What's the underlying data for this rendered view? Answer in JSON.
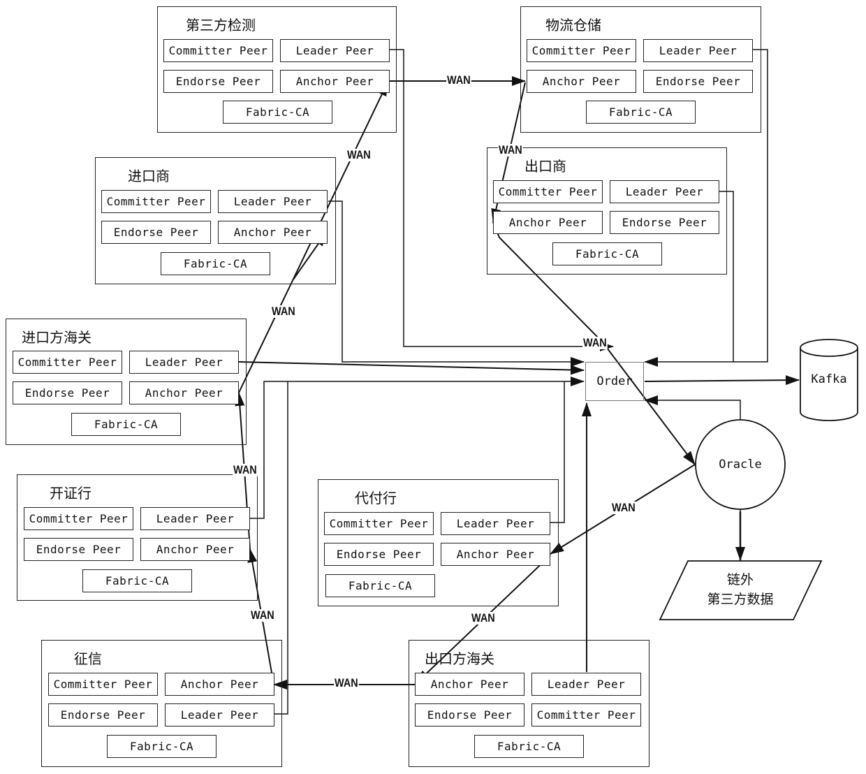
{
  "orgs": {
    "third_party_testing": {
      "title": "第三方检测",
      "peers": [
        "Committer Peer",
        "Leader Peer",
        "Endorse Peer",
        "Anchor Peer"
      ],
      "ca": "Fabric-CA"
    },
    "logistics_warehouse": {
      "title": "物流仓储",
      "peers": [
        "Committer Peer",
        "Leader Peer",
        "Anchor Peer",
        "Endorse Peer"
      ],
      "ca": "Fabric-CA"
    },
    "importer": {
      "title": "进口商",
      "peers": [
        "Committer Peer",
        "Leader Peer",
        "Endorse Peer",
        "Anchor Peer"
      ],
      "ca": "Fabric-CA"
    },
    "exporter": {
      "title": "出口商",
      "peers": [
        "Committer Peer",
        "Leader Peer",
        "Anchor Peer",
        "Endorse Peer"
      ],
      "ca": "Fabric-CA"
    },
    "import_customs": {
      "title": "进口方海关",
      "peers": [
        "Committer Peer",
        "Leader Peer",
        "Endorse Peer",
        "Anchor Peer"
      ],
      "ca": "Fabric-CA"
    },
    "issuing_bank": {
      "title": "开证行",
      "peers": [
        "Committer Peer",
        "Leader Peer",
        "Endorse Peer",
        "Anchor Peer"
      ],
      "ca": "Fabric-CA"
    },
    "paying_bank": {
      "title": "代付行",
      "peers": [
        "Committer Peer",
        "Leader Peer",
        "Endorse Peer",
        "Anchor Peer"
      ],
      "ca": "Fabric-CA"
    },
    "credit_bureau": {
      "title": "征信",
      "peers": [
        "Committer Peer",
        "Anchor Peer",
        "Endorse Peer",
        "Leader Peer"
      ],
      "ca": "Fabric-CA"
    },
    "export_customs": {
      "title": "出口方海关",
      "peers": [
        "Anchor Peer",
        "Leader Peer",
        "Endorse Peer",
        "Committer Peer"
      ],
      "ca": "Fabric-CA"
    }
  },
  "nodes": {
    "order": "Order",
    "kafka": "Kafka",
    "oracle": "Oracle",
    "offchain_line1": "链外",
    "offchain_line2": "第三方数据"
  },
  "wan_label": "WAN"
}
